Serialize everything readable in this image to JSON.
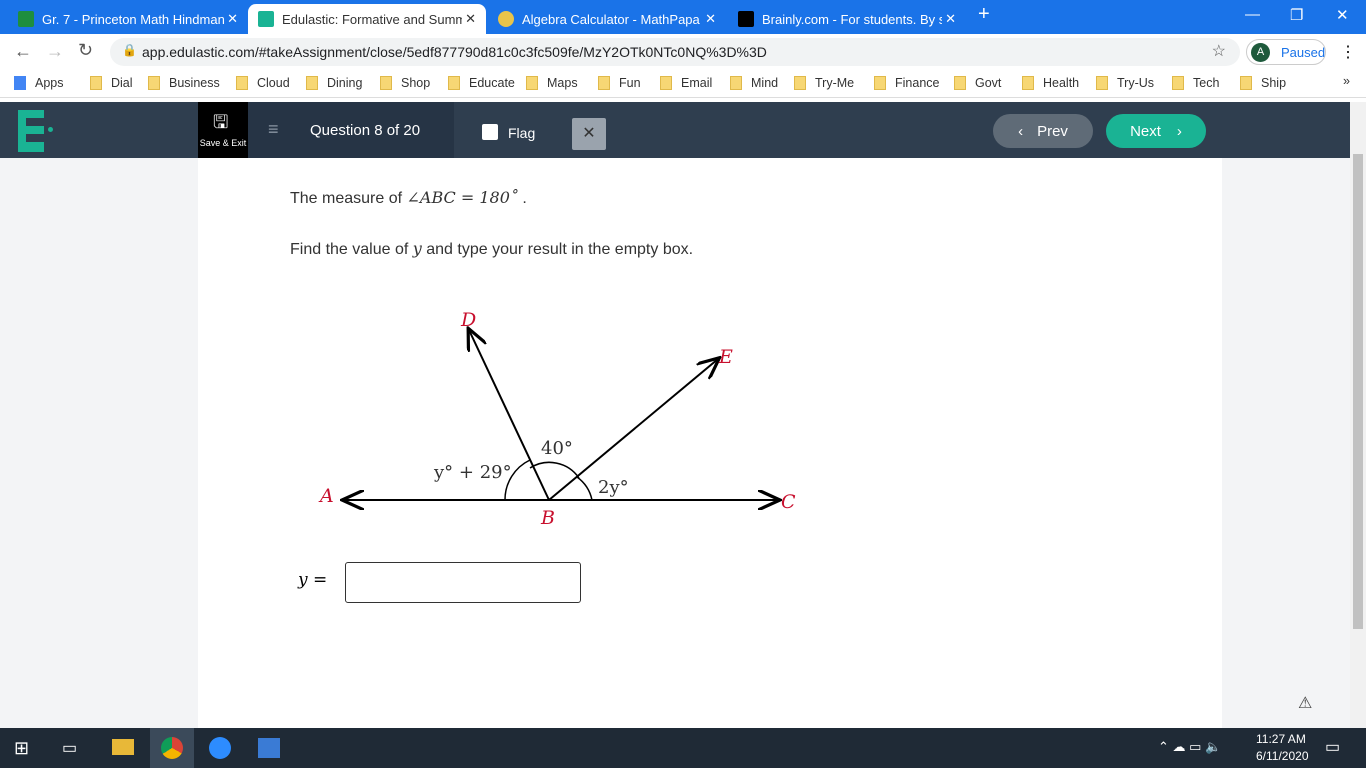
{
  "browser": {
    "tabs": [
      {
        "title": "Gr. 7 - Princeton Math Hindman",
        "icon": "classroom-icon",
        "color": "#1e8e3e"
      },
      {
        "title": "Edulastic: Formative and Summat",
        "icon": "edulastic-icon",
        "color": "#1ab394"
      },
      {
        "title": "Algebra Calculator - MathPapa",
        "icon": "mathpapa-icon",
        "color": "#e8c44a"
      },
      {
        "title": "Brainly.com - For students. By stu",
        "icon": "brainly-icon",
        "color": "#000000"
      }
    ],
    "url": "app.edulastic.com/#takeAssignment/close/5edf877790d81c0c3fc509fe/MzY2OTk0NTc0NQ%3D%3D",
    "profile_initial": "A",
    "profile_status": "Paused",
    "bookmarks": [
      "Apps",
      "Dial",
      "Business",
      "Cloud",
      "Dining",
      "Shop",
      "Educate",
      "Maps",
      "Fun",
      "Email",
      "Mind",
      "Try-Me",
      "Finance",
      "Govt",
      "Health",
      "Try-Us",
      "Tech",
      "Ship"
    ]
  },
  "toolbar": {
    "save_exit": "Save & Exit",
    "question": "Question 8 of 20",
    "flag": "Flag",
    "prev": "Prev",
    "next": "Next"
  },
  "question": {
    "line1_prefix": "The measure of ",
    "line1_math": "∠ABC = 180˚",
    "line1_suffix": " .",
    "line2_prefix": "Find the value of ",
    "line2_var": "y",
    "line2_suffix": " and type your result in the empty box.",
    "diagram": {
      "A": "A",
      "B": "B",
      "C": "C",
      "D": "D",
      "E": "E",
      "angle_left": "y° + 29°",
      "angle_mid": "40°",
      "angle_right": "2y°"
    },
    "answer_label": "y =",
    "answer_value": ""
  },
  "taskbar": {
    "time": "11:27 AM",
    "date": "6/11/2020"
  },
  "colors": {
    "accent": "#1ab394",
    "nav": "#2f3e4f",
    "label_red": "#c8102e"
  }
}
